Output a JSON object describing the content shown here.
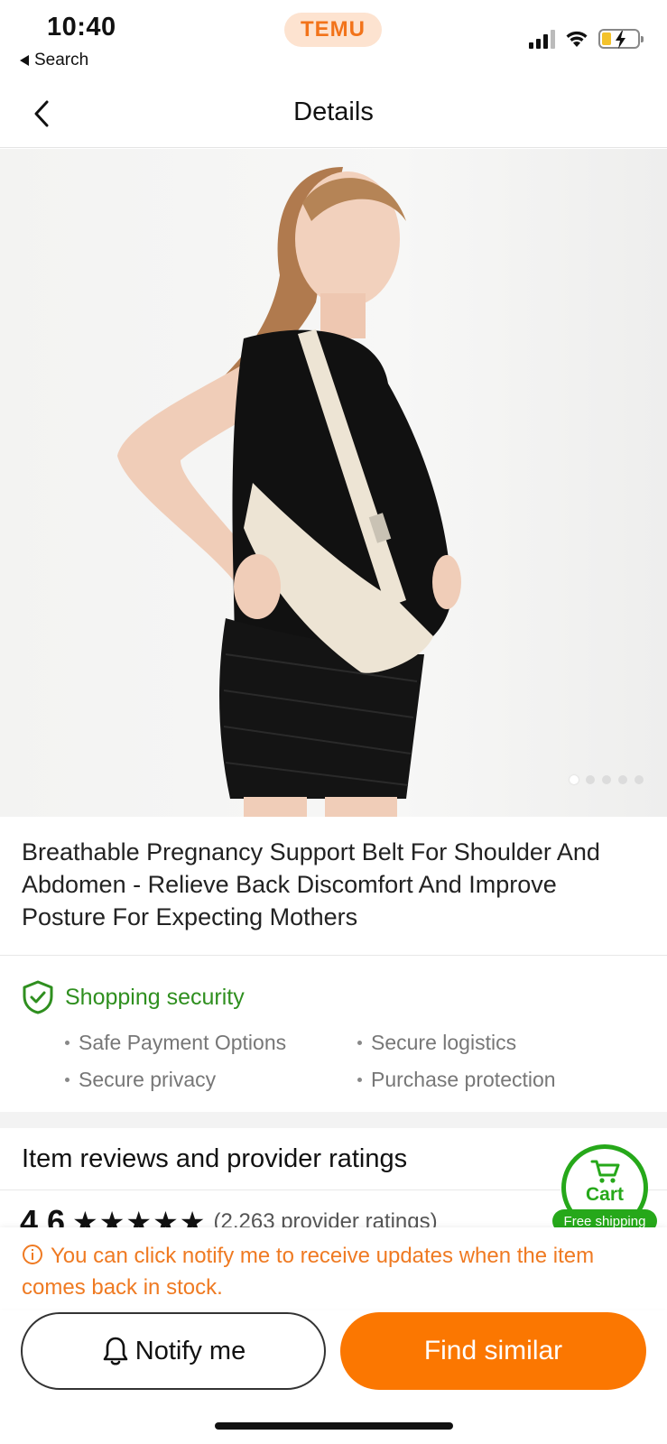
{
  "status_bar": {
    "time": "10:40",
    "back_app": "Search",
    "brand": "TEMU",
    "icons": [
      "signal-icon",
      "wifi-icon",
      "battery-charging-icon"
    ]
  },
  "header": {
    "title": "Details",
    "back_icon": "chevron-left-icon"
  },
  "gallery": {
    "image_alt": "Pregnant woman in black dress wearing a beige mesh shoulder and abdomen support belt",
    "total_images": 5,
    "current_index": 1
  },
  "product": {
    "title": "Breathable Pregnancy Support Belt For Shoulder And Abdomen - Relieve Back Discomfort And Improve Posture For Expecting Mothers"
  },
  "security": {
    "heading": "Shopping security",
    "items": [
      "Safe Payment Options",
      "Secure logistics",
      "Secure privacy",
      "Purchase protection"
    ],
    "color": "#2f8f1f"
  },
  "reviews": {
    "heading": "Item reviews and provider ratings",
    "score": "4.6",
    "stars": "★★★★★",
    "count_text": "(2,263 provider ratings)"
  },
  "cart": {
    "label": "Cart",
    "badge": "Free shipping",
    "color": "#26a81a"
  },
  "notice": {
    "text": "You can click notify me to receive updates when the item comes back in stock.",
    "color": "#ef7a22"
  },
  "actions": {
    "notify_label": "Notify me",
    "find_similar_label": "Find similar",
    "accent": "#fb7701"
  }
}
